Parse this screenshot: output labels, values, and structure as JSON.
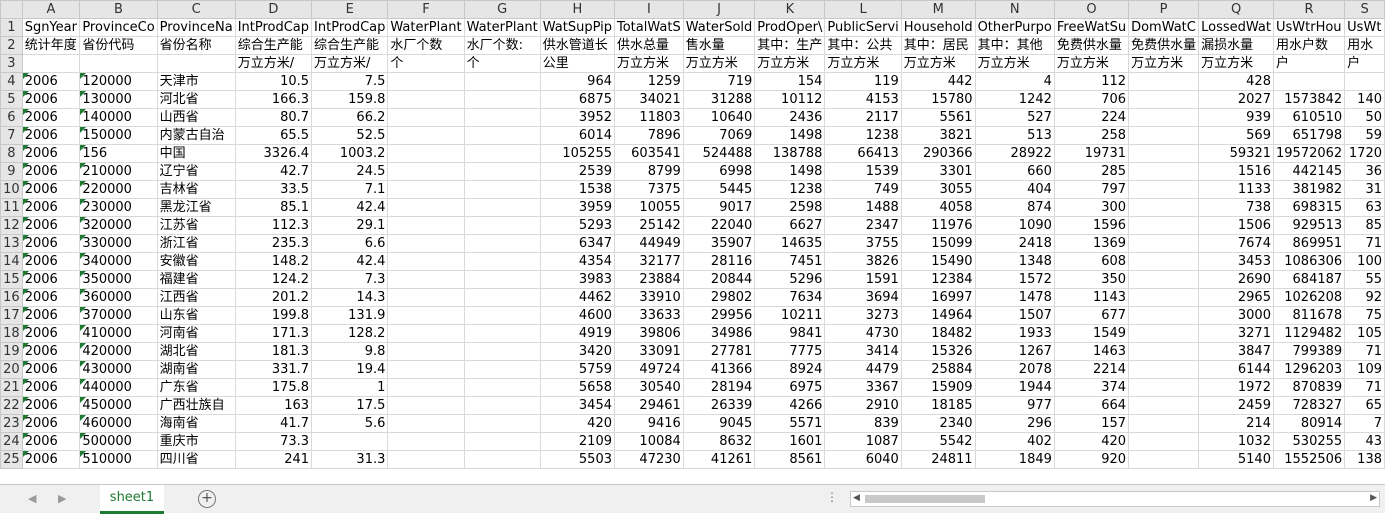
{
  "columns": [
    "A",
    "B",
    "C",
    "D",
    "E",
    "F",
    "G",
    "H",
    "I",
    "J",
    "K",
    "L",
    "M",
    "N",
    "O",
    "P",
    "Q",
    "R",
    "S"
  ],
  "header_rows": [
    {
      "num": "1",
      "cells": [
        "SgnYear",
        "ProvinceCo",
        "ProvinceNa",
        "IntProdCap",
        "IntProdCap",
        "WaterPlant",
        "WaterPlant",
        "WatSupPip",
        "TotalWatS",
        "WaterSold",
        "ProdOper\\",
        "PublicServi",
        "Household",
        "OtherPurpo",
        "FreeWatSu",
        "DomWatC",
        "LossedWat",
        "UsWtrHou",
        "UsWt"
      ]
    },
    {
      "num": "2",
      "cells": [
        "统计年度",
        "省份代码",
        "省份名称",
        "综合生产能",
        "综合生产能",
        "水厂个数",
        "水厂个数:",
        "供水管道长",
        "供水总量",
        "售水量",
        "其中：生产",
        "其中：公共",
        "其中：居民",
        "其中：其他",
        "免费供水量",
        "免费供水量",
        "漏损水量",
        "用水户数",
        "用水"
      ]
    },
    {
      "num": "3",
      "cells": [
        "",
        "",
        "",
        "万立方米/",
        "万立方米/",
        "个",
        "个",
        "公里",
        "万立方米",
        "万立方米",
        "万立方米",
        "万立方米",
        "万立方米",
        "万立方米",
        "万立方米",
        "万立方米",
        "万立方米",
        "户",
        "户"
      ]
    }
  ],
  "data_rows": [
    {
      "num": "4",
      "cells": [
        "2006",
        "120000",
        "天津市",
        "10.5",
        "7.5",
        "",
        "",
        "964",
        "1259",
        "719",
        "154",
        "119",
        "442",
        "4",
        "112",
        "",
        "428",
        "",
        ""
      ]
    },
    {
      "num": "5",
      "cells": [
        "2006",
        "130000",
        "河北省",
        "166.3",
        "159.8",
        "",
        "",
        "6875",
        "34021",
        "31288",
        "10112",
        "4153",
        "15780",
        "1242",
        "706",
        "",
        "2027",
        "1573842",
        "140"
      ]
    },
    {
      "num": "6",
      "cells": [
        "2006",
        "140000",
        "山西省",
        "80.7",
        "66.2",
        "",
        "",
        "3952",
        "11803",
        "10640",
        "2436",
        "2117",
        "5561",
        "527",
        "224",
        "",
        "939",
        "610510",
        "50"
      ]
    },
    {
      "num": "7",
      "cells": [
        "2006",
        "150000",
        "内蒙古自治",
        "65.5",
        "52.5",
        "",
        "",
        "6014",
        "7896",
        "7069",
        "1498",
        "1238",
        "3821",
        "513",
        "258",
        "",
        "569",
        "651798",
        "59"
      ]
    },
    {
      "num": "8",
      "cells": [
        "2006",
        "156",
        "中国",
        "3326.4",
        "1003.2",
        "",
        "",
        "105255",
        "603541",
        "524488",
        "138788",
        "66413",
        "290366",
        "28922",
        "19731",
        "",
        "59321",
        "19572062",
        "1720"
      ]
    },
    {
      "num": "9",
      "cells": [
        "2006",
        "210000",
        "辽宁省",
        "42.7",
        "24.5",
        "",
        "",
        "2539",
        "8799",
        "6998",
        "1498",
        "1539",
        "3301",
        "660",
        "285",
        "",
        "1516",
        "442145",
        "36"
      ]
    },
    {
      "num": "10",
      "cells": [
        "2006",
        "220000",
        "吉林省",
        "33.5",
        "7.1",
        "",
        "",
        "1538",
        "7375",
        "5445",
        "1238",
        "749",
        "3055",
        "404",
        "797",
        "",
        "1133",
        "381982",
        "31"
      ]
    },
    {
      "num": "11",
      "cells": [
        "2006",
        "230000",
        "黑龙江省",
        "85.1",
        "42.4",
        "",
        "",
        "3959",
        "10055",
        "9017",
        "2598",
        "1488",
        "4058",
        "874",
        "300",
        "",
        "738",
        "698315",
        "63"
      ]
    },
    {
      "num": "12",
      "cells": [
        "2006",
        "320000",
        "江苏省",
        "112.3",
        "29.1",
        "",
        "",
        "5293",
        "25142",
        "22040",
        "6627",
        "2347",
        "11976",
        "1090",
        "1596",
        "",
        "1506",
        "929513",
        "85"
      ]
    },
    {
      "num": "13",
      "cells": [
        "2006",
        "330000",
        "浙江省",
        "235.3",
        "6.6",
        "",
        "",
        "6347",
        "44949",
        "35907",
        "14635",
        "3755",
        "15099",
        "2418",
        "1369",
        "",
        "7674",
        "869951",
        "71"
      ]
    },
    {
      "num": "14",
      "cells": [
        "2006",
        "340000",
        "安徽省",
        "148.2",
        "42.4",
        "",
        "",
        "4354",
        "32177",
        "28116",
        "7451",
        "3826",
        "15490",
        "1348",
        "608",
        "",
        "3453",
        "1086306",
        "100"
      ]
    },
    {
      "num": "15",
      "cells": [
        "2006",
        "350000",
        "福建省",
        "124.2",
        "7.3",
        "",
        "",
        "3983",
        "23884",
        "20844",
        "5296",
        "1591",
        "12384",
        "1572",
        "350",
        "",
        "2690",
        "684187",
        "55"
      ]
    },
    {
      "num": "16",
      "cells": [
        "2006",
        "360000",
        "江西省",
        "201.2",
        "14.3",
        "",
        "",
        "4462",
        "33910",
        "29802",
        "7634",
        "3694",
        "16997",
        "1478",
        "1143",
        "",
        "2965",
        "1026208",
        "92"
      ]
    },
    {
      "num": "17",
      "cells": [
        "2006",
        "370000",
        "山东省",
        "199.8",
        "131.9",
        "",
        "",
        "4600",
        "33633",
        "29956",
        "10211",
        "3273",
        "14964",
        "1507",
        "677",
        "",
        "3000",
        "811678",
        "75"
      ]
    },
    {
      "num": "18",
      "cells": [
        "2006",
        "410000",
        "河南省",
        "171.3",
        "128.2",
        "",
        "",
        "4919",
        "39806",
        "34986",
        "9841",
        "4730",
        "18482",
        "1933",
        "1549",
        "",
        "3271",
        "1129482",
        "105"
      ]
    },
    {
      "num": "19",
      "cells": [
        "2006",
        "420000",
        "湖北省",
        "181.3",
        "9.8",
        "",
        "",
        "3420",
        "33091",
        "27781",
        "7775",
        "3414",
        "15326",
        "1267",
        "1463",
        "",
        "3847",
        "799389",
        "71"
      ]
    },
    {
      "num": "20",
      "cells": [
        "2006",
        "430000",
        "湖南省",
        "331.7",
        "19.4",
        "",
        "",
        "5759",
        "49724",
        "41366",
        "8924",
        "4479",
        "25884",
        "2078",
        "2214",
        "",
        "6144",
        "1296203",
        "109"
      ]
    },
    {
      "num": "21",
      "cells": [
        "2006",
        "440000",
        "广东省",
        "175.8",
        "1",
        "",
        "",
        "5658",
        "30540",
        "28194",
        "6975",
        "3367",
        "15909",
        "1944",
        "374",
        "",
        "1972",
        "870839",
        "71"
      ]
    },
    {
      "num": "22",
      "cells": [
        "2006",
        "450000",
        "广西壮族自",
        "163",
        "17.5",
        "",
        "",
        "3454",
        "29461",
        "26339",
        "4266",
        "2910",
        "18185",
        "977",
        "664",
        "",
        "2459",
        "728327",
        "65"
      ]
    },
    {
      "num": "23",
      "cells": [
        "2006",
        "460000",
        "海南省",
        "41.7",
        "5.6",
        "",
        "",
        "420",
        "9416",
        "9045",
        "5571",
        "839",
        "2340",
        "296",
        "157",
        "",
        "214",
        "80914",
        "7"
      ]
    },
    {
      "num": "24",
      "cells": [
        "2006",
        "500000",
        "重庆市",
        "73.3",
        "",
        "",
        "",
        "2109",
        "10084",
        "8632",
        "1601",
        "1087",
        "5542",
        "402",
        "420",
        "",
        "1032",
        "530255",
        "43"
      ]
    },
    {
      "num": "25",
      "cells": [
        "2006",
        "510000",
        "四川省",
        "241",
        "31.3",
        "",
        "",
        "5503",
        "47230",
        "41261",
        "8561",
        "6040",
        "24811",
        "1849",
        "920",
        "",
        "5140",
        "1552506",
        "138"
      ]
    }
  ],
  "sheet_tab": "sheet1",
  "add_sheet_symbol": "+",
  "ellipsis": "⋮",
  "nav_prev": "◀",
  "nav_next": "▶",
  "scroll_left": "◀",
  "scroll_right": "▶",
  "accent_color": "#1e7b34"
}
